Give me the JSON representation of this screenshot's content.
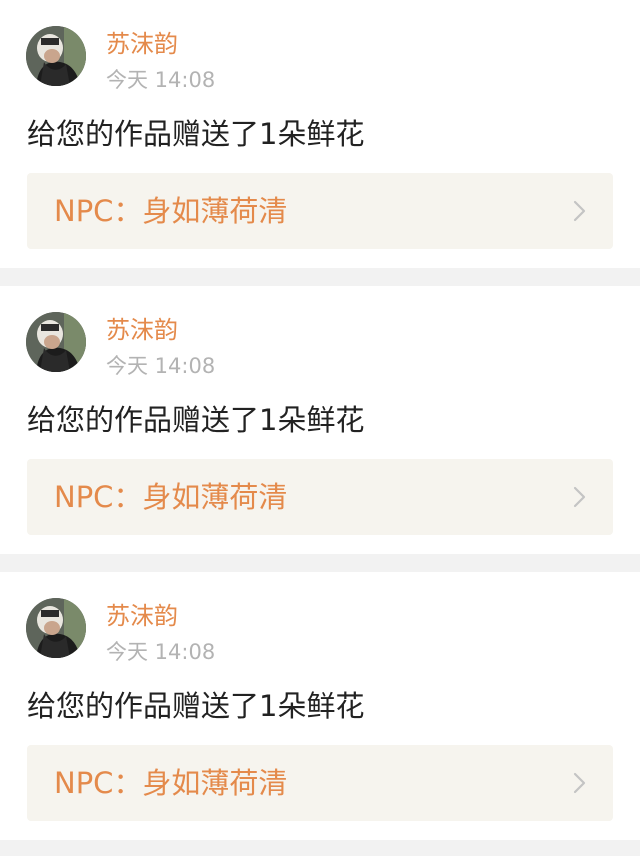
{
  "notifications": [
    {
      "username": "苏沫韵",
      "timestamp": "今天 14:08",
      "message": "给您的作品赠送了1朵鲜花",
      "work_title": "NPC：身如薄荷清"
    },
    {
      "username": "苏沫韵",
      "timestamp": "今天 14:08",
      "message": "给您的作品赠送了1朵鲜花",
      "work_title": "NPC：身如薄荷清"
    },
    {
      "username": "苏沫韵",
      "timestamp": "今天 14:08",
      "message": "给您的作品赠送了1朵鲜花",
      "work_title": "NPC：身如薄荷清"
    }
  ],
  "colors": {
    "accent": "#e48a4b",
    "timestamp": "#b3b3b3",
    "text": "#222222",
    "card_link_bg": "#f6f4ee",
    "page_bg": "#f2f2f2"
  },
  "icons": {
    "avatar": "user-avatar-photo",
    "chevron": "chevron-right-icon"
  }
}
